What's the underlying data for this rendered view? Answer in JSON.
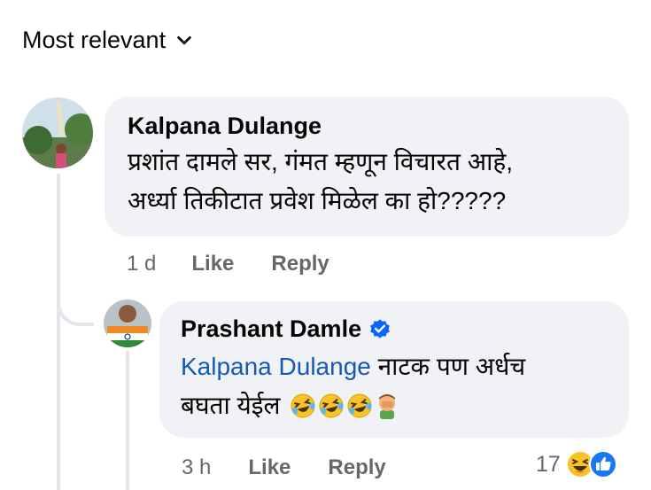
{
  "sort": {
    "label": "Most relevant"
  },
  "comments": [
    {
      "author": "Kalpana Dulange",
      "text_line1": "प्रशांत दामले सर, गंमत म्हणून विचारत आहे,",
      "text_line2": "अर्ध्या तिकीटात प्रवेश मिळेल का हो?????",
      "time": "1 d",
      "like_label": "Like",
      "reply_label": "Reply"
    }
  ],
  "reply": {
    "author": "Prashant Damle",
    "verified": true,
    "mention": "Kalpana Dulange",
    "text_part1": "नाटक पण अर्धच",
    "text_part2": "बघता येईल",
    "emojis": [
      "laughing-crying-emoji",
      "laughing-crying-emoji",
      "laughing-crying-emoji",
      "facepalm-emoji"
    ],
    "time": "3 h",
    "like_label": "Like",
    "reply_label": "Reply",
    "reaction_count": "17",
    "reaction_icons": [
      "haha-reaction-icon",
      "like-reaction-icon"
    ]
  },
  "colors": {
    "bubble": "#f0f2f5",
    "secondary_text": "#65676b",
    "mention": "#1458b8",
    "verified": "#0866ff",
    "thread_line": "#e4e6eb"
  }
}
